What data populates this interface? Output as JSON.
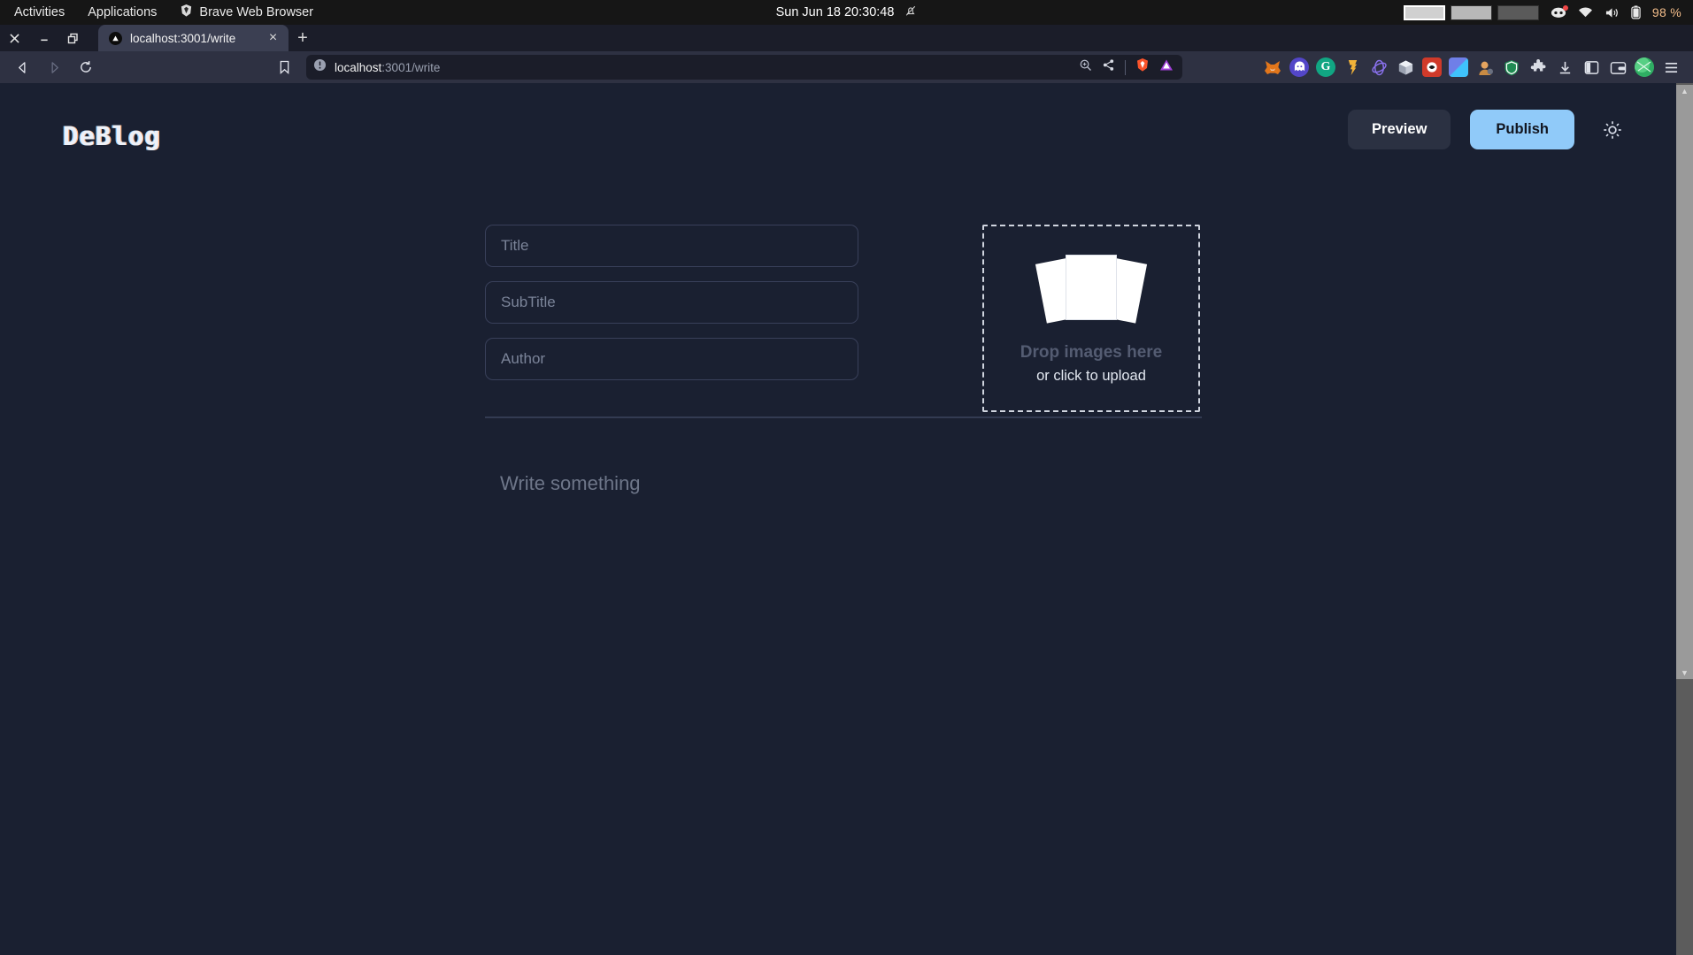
{
  "gnome": {
    "activities": "Activities",
    "applications": "Applications",
    "app_name": "Brave Web Browser",
    "app_icon": "brave-lion-icon",
    "clock": "Sun Jun 18  20:30:48",
    "notification_icon": "bell-muted-icon",
    "workspaces": [
      {
        "name": "workspace-1",
        "state": "active"
      },
      {
        "name": "workspace-2",
        "state": "mid"
      },
      {
        "name": "workspace-3",
        "state": "dim"
      }
    ],
    "tray": [
      {
        "icon": "discord-icon",
        "badge": true
      },
      {
        "icon": "wifi-icon",
        "badge": false
      },
      {
        "icon": "volume-icon",
        "badge": false
      },
      {
        "icon": "battery-icon",
        "badge": false
      }
    ],
    "battery": "98 %"
  },
  "browser": {
    "window_controls": [
      {
        "name": "close-window-button",
        "glyph": "✕"
      },
      {
        "name": "minimize-window-button",
        "glyph": "–"
      },
      {
        "name": "restore-window-button",
        "glyph": "❐"
      }
    ],
    "tab": {
      "title": "localhost:3001/write",
      "favicon": "nextjs-triangle-icon",
      "close_glyph": "×"
    },
    "new_tab_glyph": "+",
    "nav": {
      "back": "back-arrow-icon",
      "forward": "forward-arrow-icon",
      "reload": "reload-icon",
      "bookmark": "bookmark-icon"
    },
    "omnibox": {
      "site_info_icon": "info-circle-icon",
      "url_host": "localhost",
      "url_path": ":3001/write",
      "zoom_icon": "zoom-magnifier-icon",
      "share_icon": "share-icon",
      "shields_icon": "brave-shields-icon",
      "rewards_icon": "brave-rewards-icon"
    },
    "extensions": [
      {
        "name": "metamask-extension-icon",
        "glyph": "🦊",
        "bg": "transparent"
      },
      {
        "name": "phantom-wallet-extension-icon",
        "glyph": "👻",
        "bg": "#5346c8"
      },
      {
        "name": "grammarly-extension-icon",
        "glyph": "G",
        "bg": "#11a683"
      },
      {
        "name": "keplr-wallet-extension-icon",
        "glyph": "♦",
        "bg": "transparent"
      },
      {
        "name": "rabby-wallet-extension-icon",
        "glyph": "◎",
        "bg": "transparent"
      },
      {
        "name": "cube-extension-icon",
        "glyph": "⬛",
        "bg": "transparent"
      },
      {
        "name": "red-badge-extension-icon",
        "glyph": "⬛",
        "bg": "#d03a2a"
      },
      {
        "name": "blue-tile-extension-icon",
        "glyph": "⬛",
        "bg": "#5b8dfb"
      },
      {
        "name": "avatar-extension-icon",
        "glyph": "👤",
        "bg": "transparent"
      },
      {
        "name": "shield-extension-icon",
        "glyph": "⛨",
        "bg": "#1f8b52"
      },
      {
        "name": "extensions-puzzle-icon",
        "glyph": "🧩",
        "bg": "transparent"
      },
      {
        "name": "downloads-icon",
        "glyph": "⬇",
        "bg": "transparent"
      },
      {
        "name": "sidebar-toggle-icon",
        "glyph": "◧",
        "bg": "transparent"
      },
      {
        "name": "brave-wallet-icon",
        "glyph": "💳",
        "bg": "transparent"
      },
      {
        "name": "profile-avatar-icon",
        "glyph": "",
        "bg": "#2fae63"
      },
      {
        "name": "browser-menu-icon",
        "glyph": "☰",
        "bg": "transparent"
      }
    ]
  },
  "app": {
    "logo": "DeBlog",
    "preview_label": "Preview",
    "publish_label": "Publish",
    "theme_toggle_icon": "sun-icon",
    "fields": [
      {
        "name": "title-input",
        "placeholder": "Title",
        "value": ""
      },
      {
        "name": "subtitle-input",
        "placeholder": "SubTitle",
        "value": ""
      },
      {
        "name": "author-input",
        "placeholder": "Author",
        "value": ""
      }
    ],
    "dropzone": {
      "icon": "photo-stack-icon",
      "title": "Drop images here",
      "subtitle": "or click to upload"
    },
    "body_placeholder": "Write something"
  },
  "colors": {
    "page_bg": "#1a2031",
    "publish_accent": "#90caf9",
    "preview_bg": "#2b3142",
    "field_border": "#39405a"
  }
}
